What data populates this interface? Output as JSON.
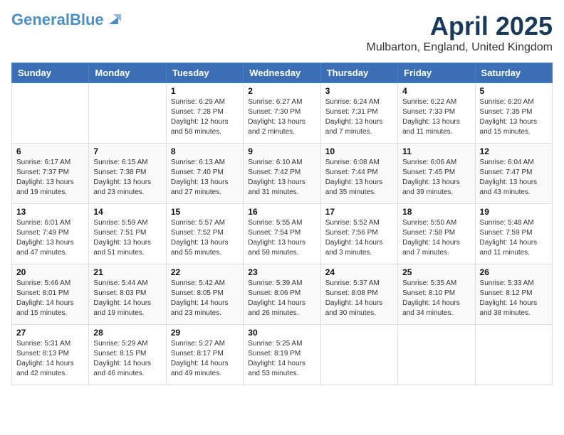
{
  "logo": {
    "text_general": "General",
    "text_blue": "Blue"
  },
  "header": {
    "title": "April 2025",
    "location": "Mulbarton, England, United Kingdom"
  },
  "weekdays": [
    "Sunday",
    "Monday",
    "Tuesday",
    "Wednesday",
    "Thursday",
    "Friday",
    "Saturday"
  ],
  "weeks": [
    [
      {
        "day": "",
        "content": ""
      },
      {
        "day": "",
        "content": ""
      },
      {
        "day": "1",
        "content": "Sunrise: 6:29 AM\nSunset: 7:28 PM\nDaylight: 12 hours\nand 58 minutes."
      },
      {
        "day": "2",
        "content": "Sunrise: 6:27 AM\nSunset: 7:30 PM\nDaylight: 13 hours\nand 2 minutes."
      },
      {
        "day": "3",
        "content": "Sunrise: 6:24 AM\nSunset: 7:31 PM\nDaylight: 13 hours\nand 7 minutes."
      },
      {
        "day": "4",
        "content": "Sunrise: 6:22 AM\nSunset: 7:33 PM\nDaylight: 13 hours\nand 11 minutes."
      },
      {
        "day": "5",
        "content": "Sunrise: 6:20 AM\nSunset: 7:35 PM\nDaylight: 13 hours\nand 15 minutes."
      }
    ],
    [
      {
        "day": "6",
        "content": "Sunrise: 6:17 AM\nSunset: 7:37 PM\nDaylight: 13 hours\nand 19 minutes."
      },
      {
        "day": "7",
        "content": "Sunrise: 6:15 AM\nSunset: 7:38 PM\nDaylight: 13 hours\nand 23 minutes."
      },
      {
        "day": "8",
        "content": "Sunrise: 6:13 AM\nSunset: 7:40 PM\nDaylight: 13 hours\nand 27 minutes."
      },
      {
        "day": "9",
        "content": "Sunrise: 6:10 AM\nSunset: 7:42 PM\nDaylight: 13 hours\nand 31 minutes."
      },
      {
        "day": "10",
        "content": "Sunrise: 6:08 AM\nSunset: 7:44 PM\nDaylight: 13 hours\nand 35 minutes."
      },
      {
        "day": "11",
        "content": "Sunrise: 6:06 AM\nSunset: 7:45 PM\nDaylight: 13 hours\nand 39 minutes."
      },
      {
        "day": "12",
        "content": "Sunrise: 6:04 AM\nSunset: 7:47 PM\nDaylight: 13 hours\nand 43 minutes."
      }
    ],
    [
      {
        "day": "13",
        "content": "Sunrise: 6:01 AM\nSunset: 7:49 PM\nDaylight: 13 hours\nand 47 minutes."
      },
      {
        "day": "14",
        "content": "Sunrise: 5:59 AM\nSunset: 7:51 PM\nDaylight: 13 hours\nand 51 minutes."
      },
      {
        "day": "15",
        "content": "Sunrise: 5:57 AM\nSunset: 7:52 PM\nDaylight: 13 hours\nand 55 minutes."
      },
      {
        "day": "16",
        "content": "Sunrise: 5:55 AM\nSunset: 7:54 PM\nDaylight: 13 hours\nand 59 minutes."
      },
      {
        "day": "17",
        "content": "Sunrise: 5:52 AM\nSunset: 7:56 PM\nDaylight: 14 hours\nand 3 minutes."
      },
      {
        "day": "18",
        "content": "Sunrise: 5:50 AM\nSunset: 7:58 PM\nDaylight: 14 hours\nand 7 minutes."
      },
      {
        "day": "19",
        "content": "Sunrise: 5:48 AM\nSunset: 7:59 PM\nDaylight: 14 hours\nand 11 minutes."
      }
    ],
    [
      {
        "day": "20",
        "content": "Sunrise: 5:46 AM\nSunset: 8:01 PM\nDaylight: 14 hours\nand 15 minutes."
      },
      {
        "day": "21",
        "content": "Sunrise: 5:44 AM\nSunset: 8:03 PM\nDaylight: 14 hours\nand 19 minutes."
      },
      {
        "day": "22",
        "content": "Sunrise: 5:42 AM\nSunset: 8:05 PM\nDaylight: 14 hours\nand 23 minutes."
      },
      {
        "day": "23",
        "content": "Sunrise: 5:39 AM\nSunset: 8:06 PM\nDaylight: 14 hours\nand 26 minutes."
      },
      {
        "day": "24",
        "content": "Sunrise: 5:37 AM\nSunset: 8:08 PM\nDaylight: 14 hours\nand 30 minutes."
      },
      {
        "day": "25",
        "content": "Sunrise: 5:35 AM\nSunset: 8:10 PM\nDaylight: 14 hours\nand 34 minutes."
      },
      {
        "day": "26",
        "content": "Sunrise: 5:33 AM\nSunset: 8:12 PM\nDaylight: 14 hours\nand 38 minutes."
      }
    ],
    [
      {
        "day": "27",
        "content": "Sunrise: 5:31 AM\nSunset: 8:13 PM\nDaylight: 14 hours\nand 42 minutes."
      },
      {
        "day": "28",
        "content": "Sunrise: 5:29 AM\nSunset: 8:15 PM\nDaylight: 14 hours\nand 46 minutes."
      },
      {
        "day": "29",
        "content": "Sunrise: 5:27 AM\nSunset: 8:17 PM\nDaylight: 14 hours\nand 49 minutes."
      },
      {
        "day": "30",
        "content": "Sunrise: 5:25 AM\nSunset: 8:19 PM\nDaylight: 14 hours\nand 53 minutes."
      },
      {
        "day": "",
        "content": ""
      },
      {
        "day": "",
        "content": ""
      },
      {
        "day": "",
        "content": ""
      }
    ]
  ]
}
